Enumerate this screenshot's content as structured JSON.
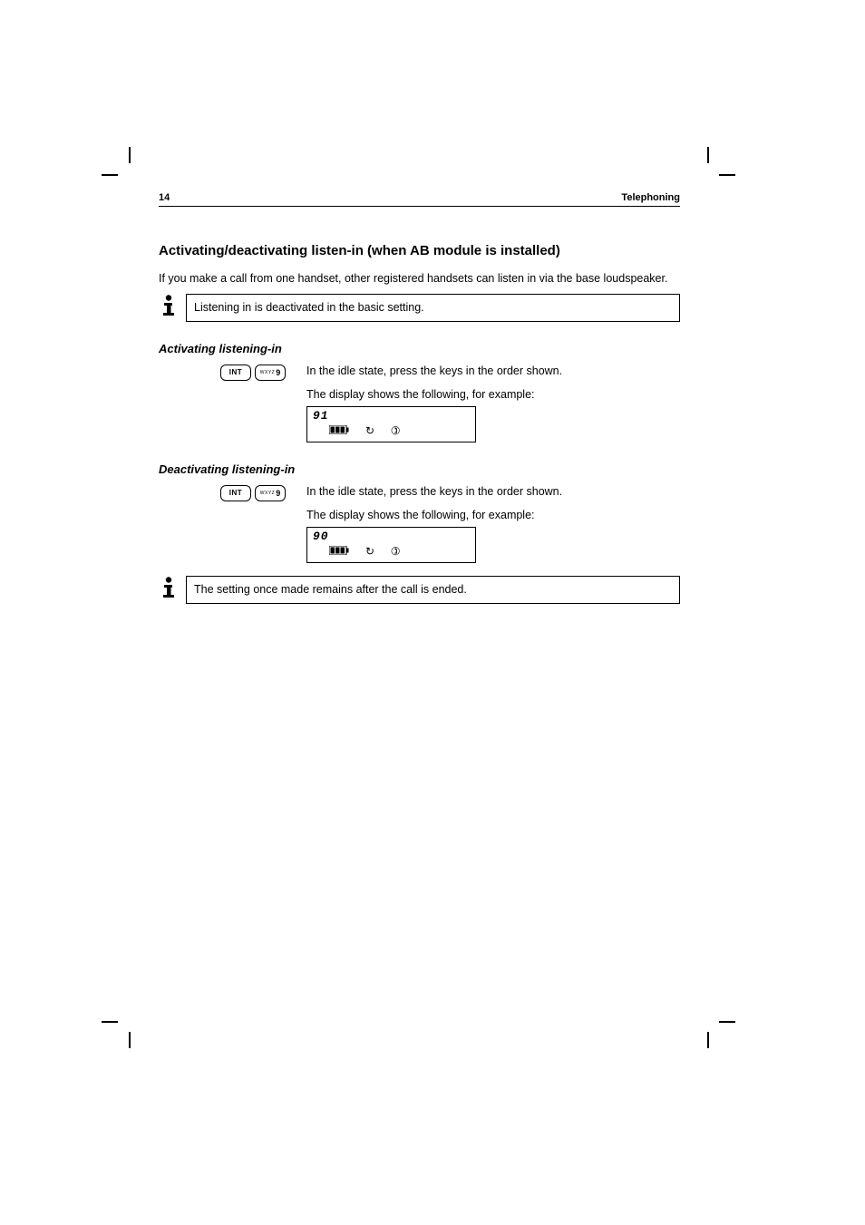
{
  "header": {
    "page_number": "14",
    "title": "Telephoning"
  },
  "intro": {
    "heading": "Activating/deactivating listen-in (when AB module is installed)",
    "paragraph": "If you make a call from one handset, other registered handsets can listen in via the base loudspeaker.",
    "info": "Listening in is deactivated in the basic setting."
  },
  "activate": {
    "heading": "Activating listening-in",
    "step_text": "In the idle state, press the keys in the order shown.",
    "display_label": "The display shows the following, for example:",
    "lcd_value": "91"
  },
  "deactivate": {
    "heading": "Deactivating listening-in",
    "step_text": "In the idle state, press the keys in the order shown.",
    "display_label": "The display shows the following, for example:",
    "lcd_value": "90",
    "info": "The setting once made remains after the call is ended."
  },
  "keys": {
    "int": "INT",
    "nine_sup": "WXYZ",
    "nine_main": "9"
  },
  "icons": {
    "redo": "↻",
    "handset": "✆"
  }
}
